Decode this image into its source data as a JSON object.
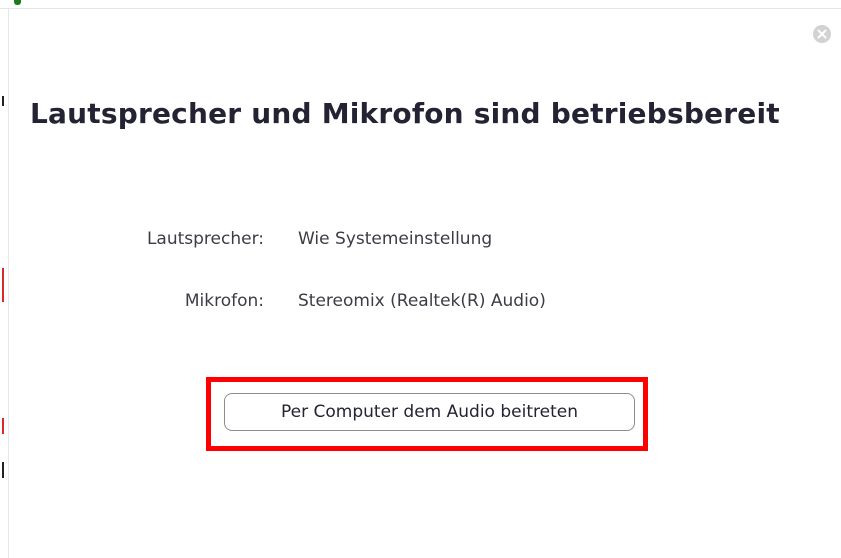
{
  "dialog": {
    "title": "Lautsprecher und Mikrofon sind betriebsbereit",
    "close_icon": "close-icon",
    "rows": [
      {
        "label": "Lautsprecher:",
        "value": "Wie Systemeinstellung"
      },
      {
        "label": "Mikrofon:",
        "value": "Stereomix (Realtek(R) Audio)"
      }
    ],
    "join_button_label": "Per Computer dem Audio beitreten"
  },
  "colors": {
    "highlight": "#ff0000",
    "title_text": "#232333",
    "body_text": "#3c3c46",
    "close_button_bg": "#d2d2d2"
  }
}
